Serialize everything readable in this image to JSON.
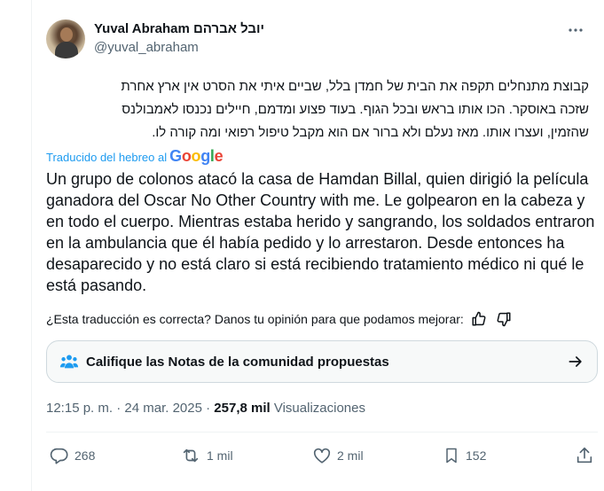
{
  "author": {
    "display_name": "Yuval Abraham יובל אברהם",
    "handle": "@yuval_abraham"
  },
  "post": {
    "original_lines": [
      "קבוצת מתנחלים תקפה את הבית של חמדן בלל, שביים איתי את הסרט אין ארץ אחרת",
      "שזכה באוסקר. הכו אותו בראש ובכל הגוף. בעוד פצוע ומדמם, חיילים נכנסו לאמבולנס",
      "שהזמין, ועצרו אותו. מאז נעלם ולא ברור אם הוא מקבל טיפול רפואי ומה קורה לו."
    ],
    "translated_from": "Traducido del hebreo al",
    "translator_logo": [
      "G",
      "o",
      "o",
      "g",
      "l",
      "e"
    ],
    "translation": "Un grupo de colonos atacó la casa de Hamdan Billal, quien dirigió la película ganadora del Oscar No Other Country with me. Le golpearon en la cabeza y en todo el cuerpo. Mientras estaba herido y sangrando, los soldados entraron en la ambulancia que él había pedido y lo arrestaron. Desde entonces ha desaparecido y no está claro si está recibiendo tratamiento médico ni qué le está pasando.",
    "feedback_question": "¿Esta traducción es correcta? Danos tu opinión para que podamos mejorar:"
  },
  "community_notes": {
    "label": "Califique las Notas de la comunidad propuestas"
  },
  "meta": {
    "time": "12:15 p. m.",
    "separator": "·",
    "date": "24 mar. 2025",
    "views_count": "257,8 mil",
    "views_label": "Visualizaciones"
  },
  "actions": {
    "replies": "268",
    "reposts": "1 mil",
    "likes": "2 mil",
    "bookmarks": "152"
  },
  "icons": {
    "more": "more-icon",
    "thumbs_up": "thumbs-up-icon",
    "thumbs_down": "thumbs-down-icon",
    "people": "people-icon",
    "arrow": "arrow-right-icon",
    "reply": "reply-icon",
    "repost": "repost-icon",
    "like": "heart-icon",
    "bookmark": "bookmark-icon",
    "share": "share-icon"
  },
  "colors": {
    "accent": "#1d9bf0",
    "text": "#0f1419",
    "muted": "#536471"
  }
}
